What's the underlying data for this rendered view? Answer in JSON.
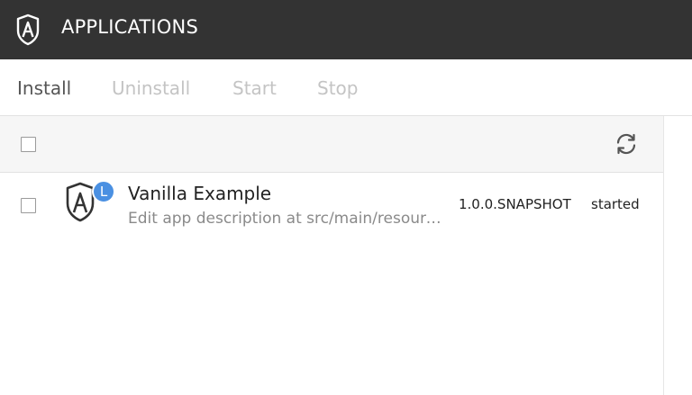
{
  "header": {
    "title": "APPLICATIONS",
    "logo_icon": "app-shield-logo"
  },
  "toolbar": {
    "install_label": "Install",
    "uninstall_label": "Uninstall",
    "start_label": "Start",
    "stop_label": "Stop"
  },
  "list": {
    "refresh_icon": "refresh-icon",
    "rows": [
      {
        "name": "Vanilla Example",
        "description": "Edit app description at src/main/resources/...",
        "version": "1.0.0.SNAPSHOT",
        "status": "started",
        "badge": "L"
      }
    ]
  },
  "colors": {
    "header_bg": "#333333",
    "badge": "#4a90e2",
    "disabled_text": "#c4c4c4",
    "enabled_text": "#555555"
  }
}
